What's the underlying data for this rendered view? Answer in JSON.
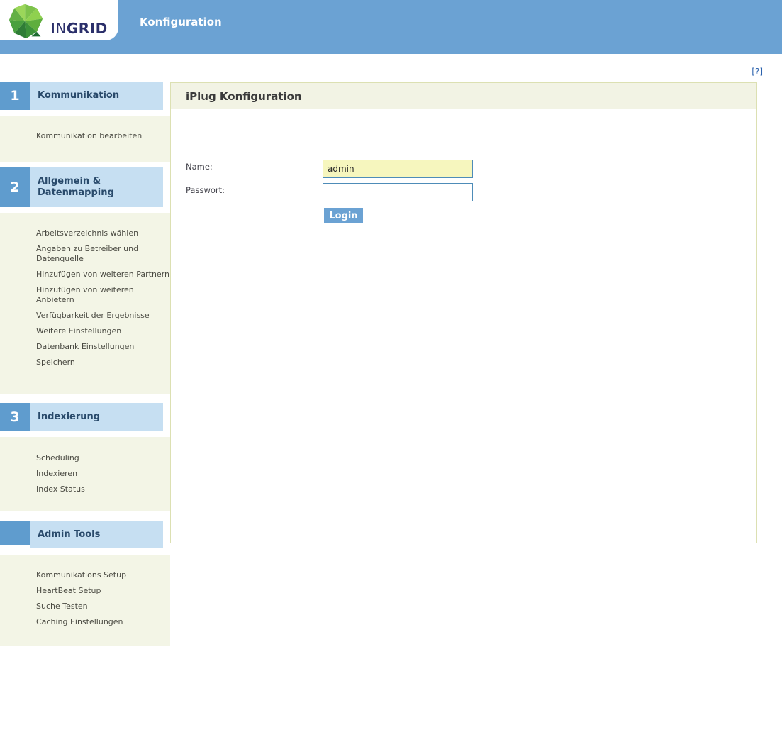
{
  "topbar": {
    "app_title": "Konfiguration",
    "logo": {
      "text_light": "IN",
      "text_bold": "GRID"
    }
  },
  "help_link_label": "[?]",
  "sidebar": {
    "sections": [
      {
        "number": "1",
        "title": "Kommunikation",
        "links": [
          "Kommunikation bearbeiten"
        ]
      },
      {
        "number": "2",
        "title": "Allgemein & Datenmapping",
        "links": [
          "Arbeitsverzeichnis wählen",
          "Angaben zu Betreiber und Datenquelle",
          "Hinzufügen von weiteren Partnern",
          "Hinzufügen von weiteren Anbietern",
          "Verfügbarkeit der Ergebnisse",
          "Weitere Einstellungen",
          "Datenbank Einstellungen",
          "Speichern"
        ]
      },
      {
        "number": "3",
        "title": "Indexierung",
        "links": [
          "Scheduling",
          "Indexieren",
          "Index Status"
        ]
      },
      {
        "number": "",
        "title": "Admin Tools",
        "links": [
          "Kommunikations Setup",
          "HeartBeat Setup",
          "Suche Testen",
          "Caching Einstellungen"
        ]
      }
    ]
  },
  "main": {
    "panel_title": "iPlug Konfiguration",
    "login_form": {
      "name_label": "Name:",
      "name_value": "admin",
      "password_label": "Passwort:",
      "password_value": "",
      "login_button_label": "Login"
    }
  },
  "colors": {
    "topbar_blue": "#6BA2D3",
    "section_number_blue": "#5F9CCE",
    "section_bar_blue": "#C6DFF2",
    "section_title_navy": "#294A6B",
    "sidebar_cream": "#F3F5E6",
    "panel_header_cream": "#F2F3E4",
    "panel_border_olive": "#DCE0B2",
    "link_text_gray": "#4A4A42",
    "help_link_blue": "#2B62AD",
    "input_border_blue": "#4E8CB8",
    "name_input_yellow": "#F6F6BE",
    "login_button_blue": "#6BA2D3"
  }
}
